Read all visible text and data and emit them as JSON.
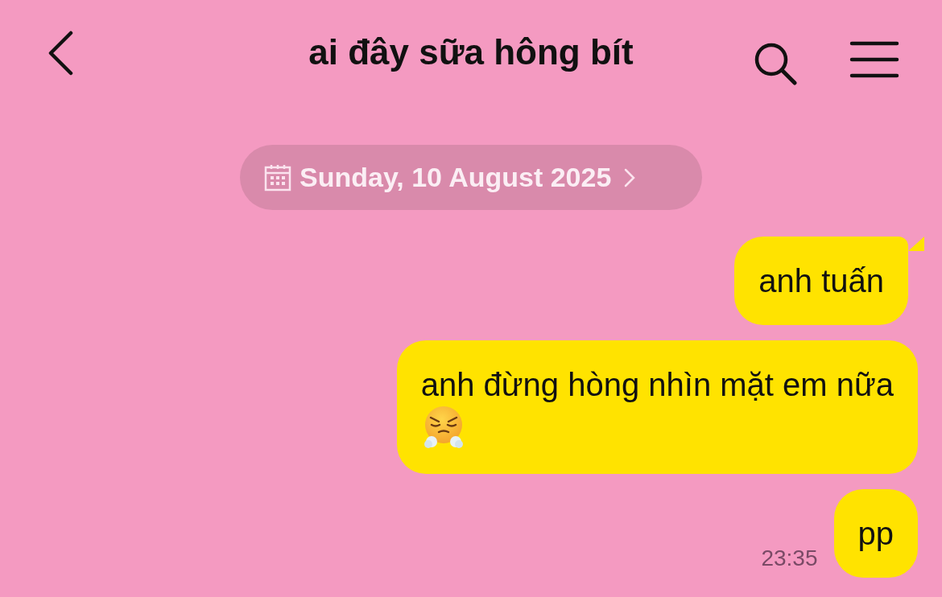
{
  "header": {
    "title": "ai đây sữa hông bít"
  },
  "date_chip": {
    "label": "Sunday, 10 August 2025"
  },
  "messages": [
    {
      "text": "anh tuấn",
      "tail": true,
      "emoji": false
    },
    {
      "text": "anh đừng hòng nhìn mặt em nữa",
      "tail": false,
      "emoji": true
    },
    {
      "text": "pp",
      "tail": false,
      "emoji": false,
      "time": "23:35"
    }
  ]
}
